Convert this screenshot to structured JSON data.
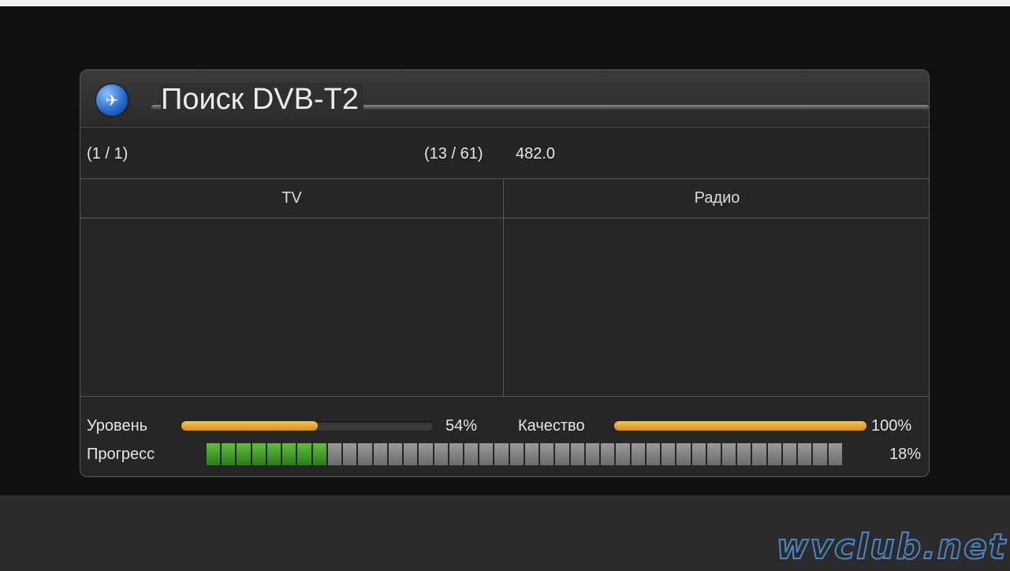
{
  "window": {
    "title": "Поиск DVB-T2"
  },
  "scan": {
    "page": "(1 / 1)",
    "channel": "(13 / 61)",
    "frequency": "482.0"
  },
  "columns": {
    "tv": "TV",
    "radio": "Радио"
  },
  "meters": {
    "level_label": "Уровень",
    "level_value": 0.54,
    "level_text": "54%",
    "quality_label": "Качество",
    "quality_value": 1.0,
    "quality_text": "100%",
    "progress_label": "Прогресс",
    "progress_value": 0.18,
    "progress_text": "18%"
  },
  "icons": {
    "title_icon": "satellite-globe-icon"
  },
  "watermark": "wvclub.net",
  "colors": {
    "accent": "#e2a22c",
    "progress_on": "#4aa52c",
    "progress_off": "#8a8a8a"
  }
}
